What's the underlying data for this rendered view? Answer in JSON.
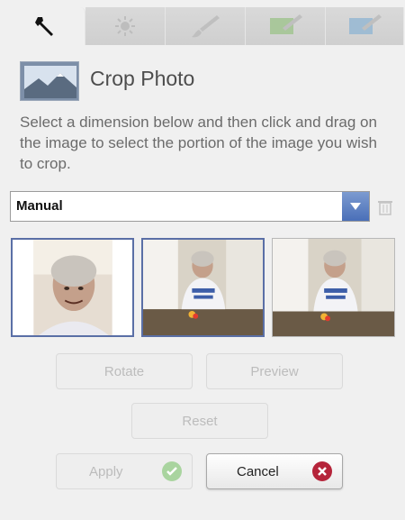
{
  "tabs": [
    {
      "icon": "wrench-icon",
      "active": true
    },
    {
      "icon": "sun-icon",
      "active": false
    },
    {
      "icon": "brush-icon",
      "active": false
    },
    {
      "icon": "brush-green-icon",
      "active": false
    },
    {
      "icon": "brush-blue-icon",
      "active": false
    }
  ],
  "header": {
    "title": "Crop Photo"
  },
  "instructions": "Select a dimension below and then click and drag on the image to select the portion of the image you wish to crop.",
  "dimension": {
    "value": "Manual"
  },
  "buttons": {
    "rotate": "Rotate",
    "preview": "Preview",
    "reset": "Reset",
    "apply": "Apply",
    "cancel": "Cancel"
  },
  "colors": {
    "accent": "#4a6fb8",
    "apply_badge": "#7cc46f",
    "cancel_badge": "#b5243a"
  }
}
